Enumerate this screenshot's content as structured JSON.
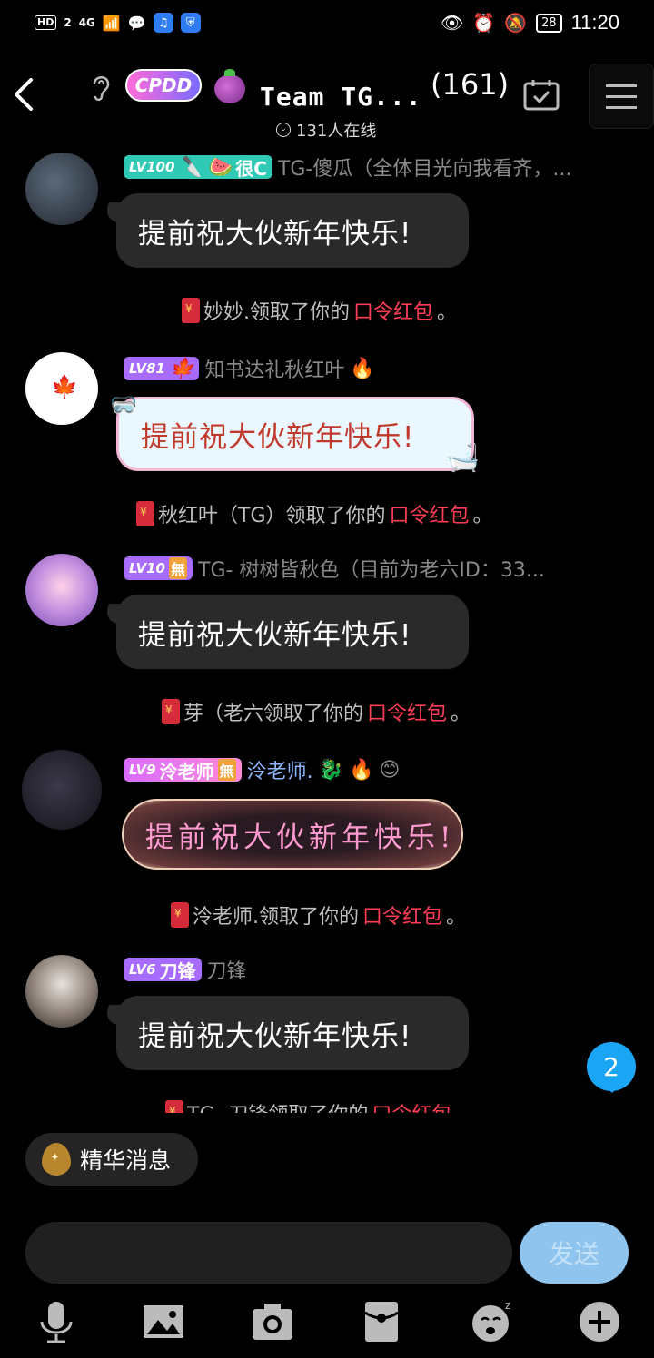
{
  "status_bar": {
    "hd": "HD",
    "sim": "2",
    "signal": "4G",
    "battery": "28",
    "time": "11:20"
  },
  "header": {
    "cpdd": "CPDD",
    "title": "Team  TG...",
    "member_count": "(161)",
    "online_text": "131人在线"
  },
  "messages": [
    {
      "level": "LV100",
      "tag": "很C",
      "level_color": "#2fc9b5",
      "nickname": "TG-傻瓜（全体目光向我看齐，...",
      "text": "提前祝大伙新年快乐!",
      "system": {
        "name": "妙妙.领取了你的",
        "red": "口令红包",
        "end": "。"
      }
    },
    {
      "level": "LV81",
      "tag": "",
      "level_color": "#a86bff",
      "nickname": "知书达礼秋红叶",
      "text": "提前祝大伙新年快乐!",
      "system": {
        "name": "秋红叶（TG）领取了你的",
        "red": "口令红包",
        "end": "。"
      }
    },
    {
      "level": "LV10",
      "tag": "無",
      "level_color": "#a86bff",
      "nickname": "TG- 树树皆秋色（目前为老六ID：33...",
      "text": "提前祝大伙新年快乐!",
      "system": {
        "name": "芽（老六领取了你的",
        "red": "口令红包",
        "end": "。"
      }
    },
    {
      "level": "LV9",
      "tag": "泠老师",
      "tag2": "無",
      "level_color": "#d86bff",
      "nickname": "泠老师.",
      "text": "提前祝大伙新年快乐!",
      "system": {
        "name": "泠老师.领取了你的",
        "red": "口令红包",
        "end": "。"
      }
    },
    {
      "level": "LV6",
      "tag": "刀锋",
      "level_color": "#a86bff",
      "nickname": "刀锋",
      "text": "提前祝大伙新年快乐!",
      "system": {
        "name": "TG- 刀锋领取了你的",
        "red": "口令红包",
        "end": ""
      }
    }
  ],
  "unread_badge": "2",
  "essence_label": "精华消息",
  "input": {
    "placeholder": ""
  },
  "send_label": "发送",
  "icons": [
    "mic-icon",
    "image-icon",
    "camera-icon",
    "red-packet-icon",
    "emoji-icon",
    "plus-icon"
  ]
}
